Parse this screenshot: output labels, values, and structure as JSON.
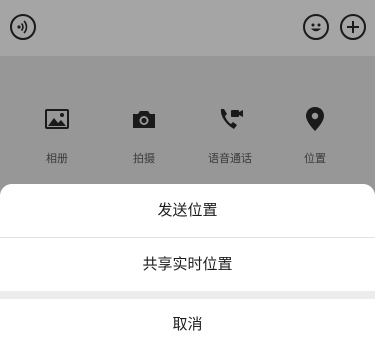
{
  "input_bar": {
    "left_icon": "voice-icon",
    "right_icons": [
      "emoji-icon",
      "plus-icon"
    ]
  },
  "tools": [
    {
      "icon": "photo-icon",
      "label": "相册"
    },
    {
      "icon": "camera-icon",
      "label": "拍摄"
    },
    {
      "icon": "video-call-icon",
      "label": "语音通话"
    },
    {
      "icon": "location-icon",
      "label": "位置"
    }
  ],
  "action_sheet": {
    "send_location": "发送位置",
    "share_live_location": "共享实时位置",
    "cancel": "取消"
  }
}
